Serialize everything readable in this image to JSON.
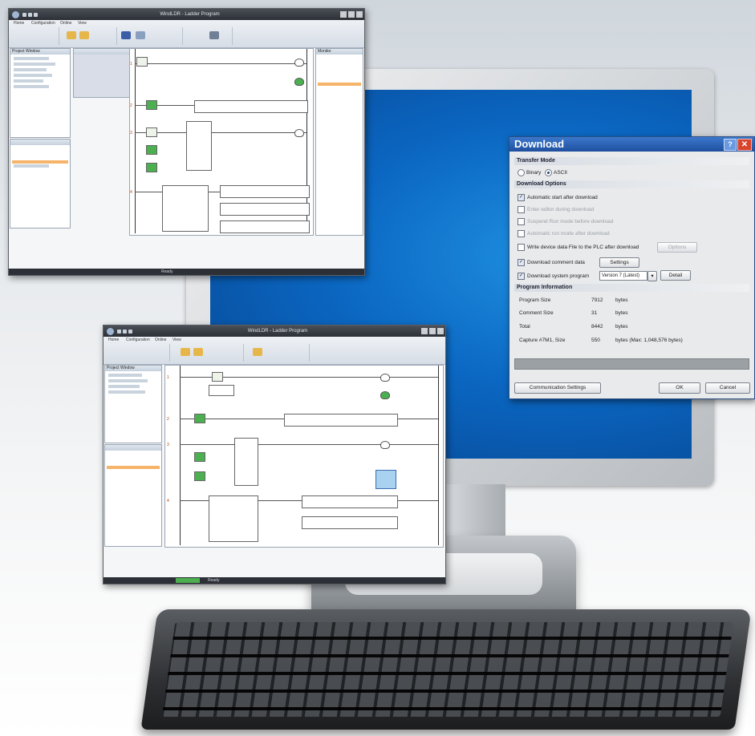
{
  "dialog": {
    "title": "Download",
    "help_glyph": "?",
    "close_glyph": "✕",
    "transfer_mode": {
      "header": "Transfer Mode",
      "options": [
        "Binary",
        "ASCII"
      ],
      "selected": "ASCII"
    },
    "download_options": {
      "header": "Download Options",
      "items": [
        {
          "label": "Automatic start after download",
          "checked": true,
          "enabled": true
        },
        {
          "label": "Enter editor during download",
          "checked": false,
          "enabled": false
        },
        {
          "label": "Suspend Run mode before download",
          "checked": false,
          "enabled": false
        },
        {
          "label": "Automatic run mode after download",
          "checked": false,
          "enabled": false
        },
        {
          "label": "Write device data File to the PLC after download",
          "checked": false,
          "enabled": true
        },
        {
          "label": "Download comment data",
          "checked": true,
          "enabled": true
        },
        {
          "label": "Download system program",
          "checked": true,
          "enabled": true
        }
      ],
      "options_button": "Options",
      "settings_button": "Settings",
      "system_program_version": "Version 7 (Latest)",
      "detail_button": "Detail"
    },
    "program_information": {
      "header": "Program Information",
      "rows": [
        {
          "key": "Program Size",
          "value": "7912",
          "unit": "bytes"
        },
        {
          "key": "Comment Size",
          "value": "31",
          "unit": "bytes"
        },
        {
          "key": "Total",
          "value": "8442",
          "unit": "bytes"
        },
        {
          "key": "Capture #7M1, Size",
          "value": "550",
          "unit": "bytes (Max: 1,048,576 bytes)"
        }
      ]
    },
    "progress_fraction": 0.0,
    "communication_settings_button": "Communication Settings",
    "ok_button": "OK",
    "cancel_button": "Cancel"
  },
  "window_top": {
    "title": "WindLDR - Ladder Program",
    "tabs": [
      "Home",
      "Configuration",
      "Online",
      "View"
    ],
    "left_panel_title": "Project Window",
    "right_panel_title": "Monitor",
    "status_text": "Ready"
  },
  "window_bottom": {
    "title": "WindLDR - Ladder Program",
    "tabs": [
      "Home",
      "Configuration",
      "Online",
      "View"
    ],
    "left_panel_title": "Project Window",
    "status_text": "Ready"
  },
  "colors": {
    "desktop_blue": "#0b67c2",
    "dialog_title": "#1f4f9e",
    "energized_coil": "#4caf50",
    "rung_number": "#c04000"
  }
}
